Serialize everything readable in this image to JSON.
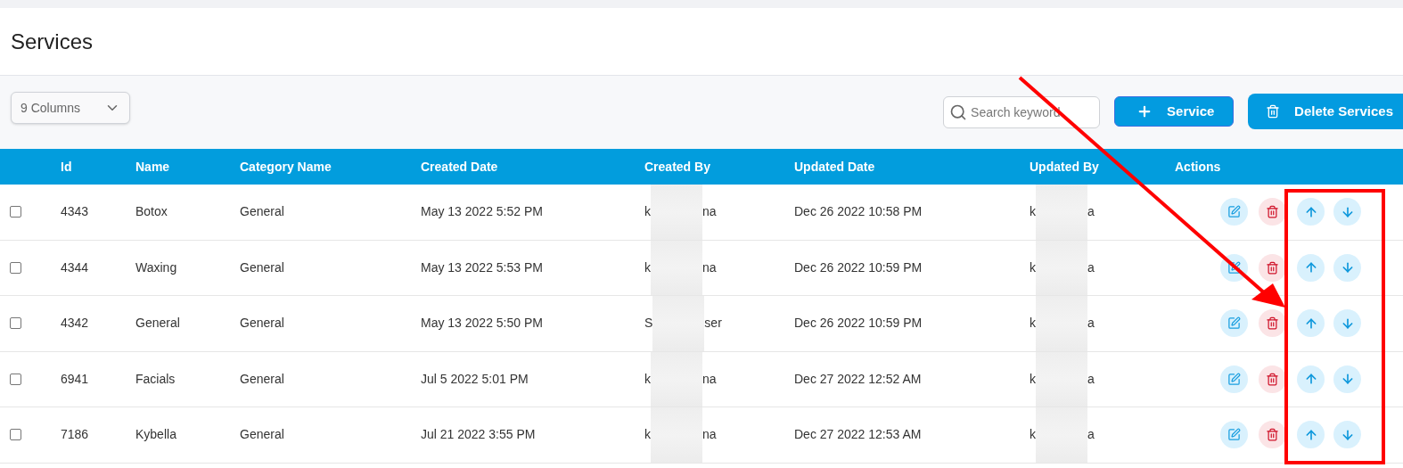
{
  "page": {
    "title": "Services"
  },
  "toolbar": {
    "columns_select": "9 Columns",
    "search": {
      "placeholder": "Search keyword"
    },
    "buttons": [
      {
        "kind": "add",
        "label": "Service"
      },
      {
        "kind": "delete",
        "label": "Delete Services"
      }
    ]
  },
  "table": {
    "columns": [
      "Id",
      "Name",
      "Category Name",
      "Created Date",
      "Created By",
      "Updated Date",
      "Updated By",
      "Actions"
    ],
    "rows": [
      {
        "checked": false,
        "id": "4343",
        "name": "Botox",
        "category": "General",
        "created_date": "May 13 2022 5:52 PM",
        "created_by": {
          "start": "k",
          "end": "na"
        },
        "updated_date": "Dec 26 2022 10:58 PM",
        "updated_by": {
          "start": "k",
          "end": "a"
        }
      },
      {
        "checked": false,
        "id": "4344",
        "name": "Waxing",
        "category": "General",
        "created_date": "May 13 2022 5:53 PM",
        "created_by": {
          "start": "k",
          "end": "na"
        },
        "updated_date": "Dec 26 2022 10:59 PM",
        "updated_by": {
          "start": "k",
          "end": "a"
        }
      },
      {
        "checked": false,
        "id": "4342",
        "name": "General",
        "category": "General",
        "created_date": "May 13 2022 5:50 PM",
        "created_by": {
          "start": "S",
          "end": "ser"
        },
        "updated_date": "Dec 26 2022 10:59 PM",
        "updated_by": {
          "start": "k",
          "end": "a"
        }
      },
      {
        "checked": false,
        "id": "6941",
        "name": "Facials",
        "category": "General",
        "created_date": "Jul 5 2022 5:01 PM",
        "created_by": {
          "start": "k",
          "end": "na"
        },
        "updated_date": "Dec 27 2022 12:52 AM",
        "updated_by": {
          "start": "k",
          "end": "a"
        }
      },
      {
        "checked": false,
        "id": "7186",
        "name": "Kybella",
        "category": "General",
        "created_date": "Jul 21 2022 3:55 PM",
        "created_by": {
          "start": "k",
          "end": "na"
        },
        "updated_date": "Dec 27 2022 12:53 AM",
        "updated_by": {
          "start": "k",
          "end": "a"
        }
      }
    ]
  },
  "annotation": {
    "arrow": true,
    "highlight_box": true
  }
}
